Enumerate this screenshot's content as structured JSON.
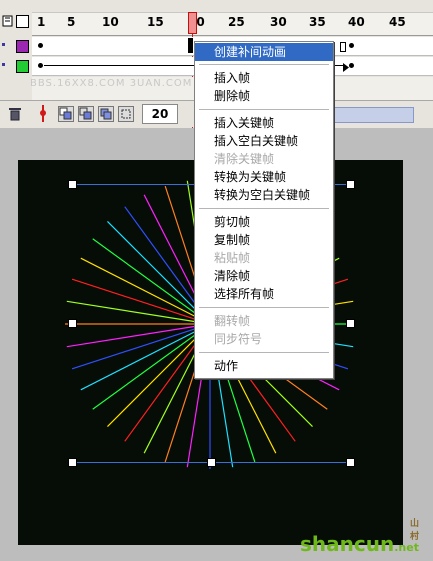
{
  "timeline": {
    "ruler_numbers": [
      "1",
      "5",
      "10",
      "15",
      "20",
      "25",
      "30",
      "35",
      "40",
      "45"
    ],
    "current_frame": "20",
    "controls": {
      "frame_rate_value": "20"
    }
  },
  "menu": {
    "items": [
      {
        "label": "创建补间动画",
        "state": "selected"
      },
      {
        "label": "插入帧",
        "state": "enabled"
      },
      {
        "label": "删除帧",
        "state": "enabled"
      },
      {
        "label": "插入关键帧",
        "state": "enabled"
      },
      {
        "label": "插入空白关键帧",
        "state": "enabled"
      },
      {
        "label": "清除关键帧",
        "state": "disabled"
      },
      {
        "label": "转换为关键帧",
        "state": "enabled"
      },
      {
        "label": "转换为空白关键帧",
        "state": "enabled"
      },
      {
        "label": "剪切帧",
        "state": "enabled"
      },
      {
        "label": "复制帧",
        "state": "enabled"
      },
      {
        "label": "粘贴帧",
        "state": "disabled"
      },
      {
        "label": "清除帧",
        "state": "enabled"
      },
      {
        "label": "选择所有帧",
        "state": "enabled"
      },
      {
        "label": "翻转帧",
        "state": "disabled"
      },
      {
        "label": "同步符号",
        "state": "disabled"
      },
      {
        "label": "动作",
        "state": "enabled"
      }
    ]
  },
  "watermark": {
    "top_left": "BBS.16XX8.COM  3UAN.COM",
    "brand": "shancun",
    "brand_suffix": ".net",
    "brand_cn": "山村"
  },
  "colors": {
    "menu_highlight": "#316ac5",
    "stage_bg": "#060c06",
    "selection_line": "#3b6fd8",
    "playhead": "#d01818",
    "layer1": "#9c27b0",
    "layer2": "#22cc33"
  },
  "icons": [
    "eye-icon",
    "outline-icon",
    "trash-icon",
    "onion-skin-icon",
    "onion-outline-icon",
    "edit-multiple-icon",
    "modify-markers-icon",
    "center-frame-icon",
    "playhead-icon"
  ]
}
